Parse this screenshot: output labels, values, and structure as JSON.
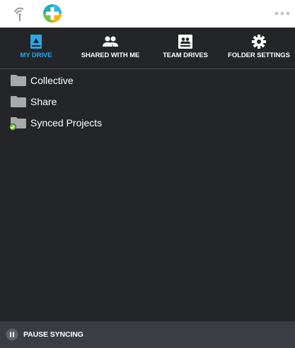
{
  "header": {
    "signal_icon": "signal-icon",
    "logo_icon": "plus-circle-logo-icon",
    "more_icon": "more-dots-icon"
  },
  "nav": {
    "items": [
      {
        "label": "MY DRIVE",
        "icon": "drive-icon",
        "active": true
      },
      {
        "label": "SHARED WITH ME",
        "icon": "people-icon",
        "active": false
      },
      {
        "label": "TEAM DRIVES",
        "icon": "team-drive-icon",
        "active": false
      },
      {
        "label": "FOLDER SETTINGS",
        "icon": "gear-icon",
        "active": false
      }
    ],
    "active_color": "#2aa8e6"
  },
  "folders": [
    {
      "name": "Collective",
      "synced": false
    },
    {
      "name": "Share",
      "synced": false
    },
    {
      "name": "Synced Projects",
      "synced": true
    }
  ],
  "footer": {
    "pause_label": "PAUSE SYNCING",
    "pause_icon": "pause-icon"
  },
  "colors": {
    "background": "#232529",
    "footer": "#3a3d42",
    "accent": "#2aa8e6",
    "sync_badge": "#7ac143"
  }
}
